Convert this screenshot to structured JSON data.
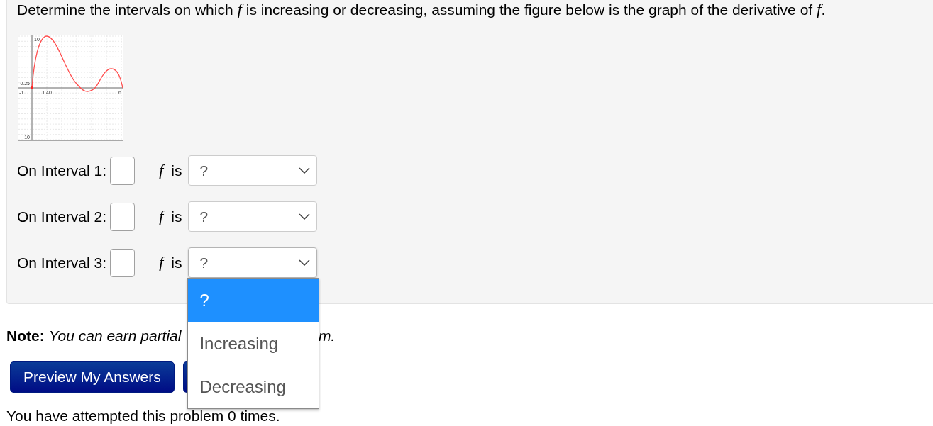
{
  "question": {
    "text": "Determine the intervals on which *f* is increasing or decreasing, assuming the figure below is the graph of the derivative of *f*."
  },
  "graph": {
    "labels": [
      {
        "kind": "y-max",
        "text": "10"
      },
      {
        "kind": "origin",
        "text": "0.25"
      },
      {
        "kind": "x-min",
        "text": "-1"
      },
      {
        "kind": "x-tick",
        "text": "1.40"
      },
      {
        "kind": "x-max",
        "text": "6"
      },
      {
        "kind": "y-min",
        "text": "-10"
      }
    ]
  },
  "intervals": [
    {
      "label": "On Interval 1:",
      "verb": "*f* is",
      "select": {
        "value": "?",
        "expanded": false
      }
    },
    {
      "label": "On Interval 2:",
      "verb": "*f* is",
      "select": {
        "value": "?",
        "expanded": false
      }
    },
    {
      "label": "On Interval 3:",
      "verb": "*f* is",
      "select": {
        "value": "?",
        "expanded": true,
        "options": [
          {
            "label": "?",
            "selected": true
          },
          {
            "label": "Increasing",
            "selected": false
          },
          {
            "label": "Decreasing",
            "selected": false
          }
        ]
      }
    }
  ],
  "note": {
    "label": "Note:",
    "text": "You can earn partial",
    "text_end": "m."
  },
  "buttons": [
    {
      "kind": "labeled",
      "label": "Preview My Answers"
    },
    {
      "kind": "covered"
    }
  ],
  "attempts": {
    "text": "You have attempted this problem 0 times."
  }
}
